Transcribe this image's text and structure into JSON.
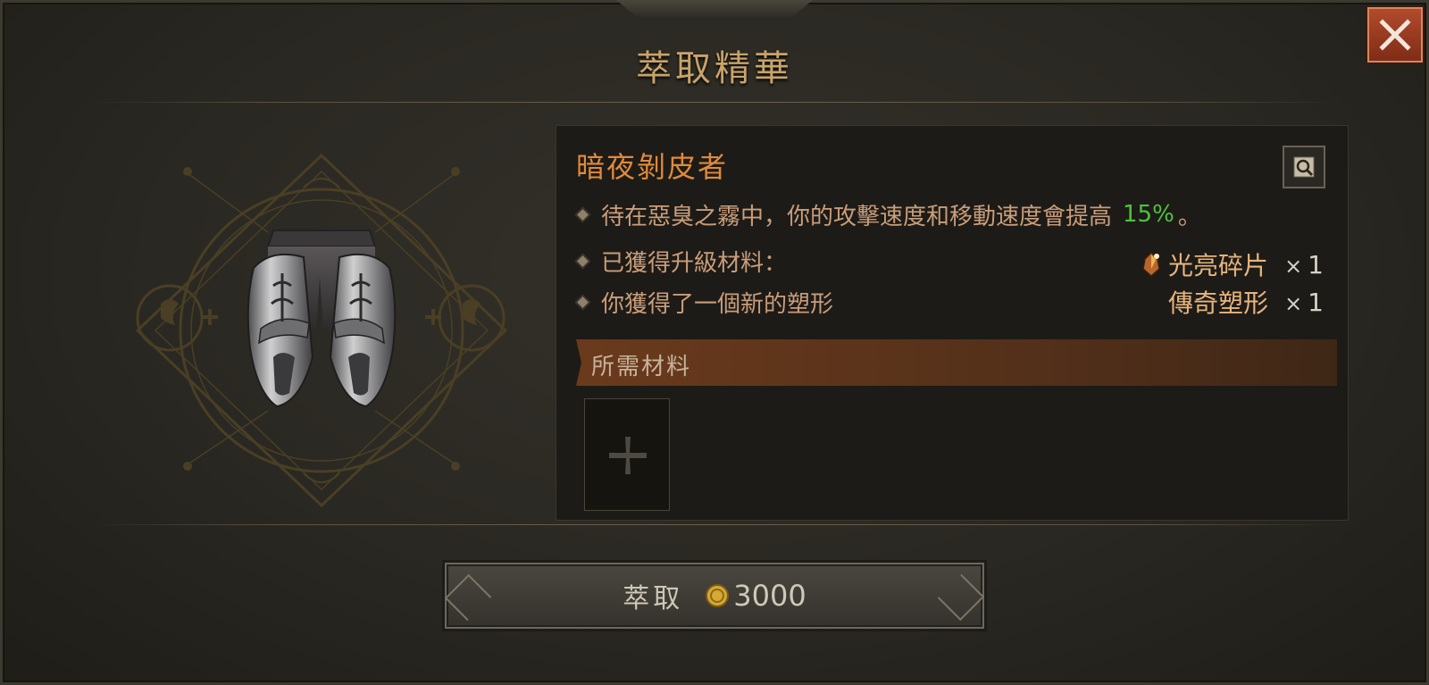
{
  "dialog": {
    "title": "萃取精華",
    "close_icon": "close-icon"
  },
  "item": {
    "name": "暗夜剝皮者",
    "image_icon": "leg-armor-pants-icon",
    "inspect_icon": "magnify-scroll-icon"
  },
  "effects": [
    {
      "text": "待在惡臭之霧中，你的攻擊速度和移動速度會提高",
      "value": "15%",
      "suffix": "。"
    },
    {
      "text": "已獲得升級材料："
    },
    {
      "text": "你獲得了一個新的塑形"
    }
  ],
  "rewards": [
    {
      "name": "光亮碎片",
      "prefix": "×",
      "count": "1",
      "icon": "shard-icon"
    },
    {
      "name": "傳奇塑形",
      "prefix": "×",
      "count": "1"
    }
  ],
  "requirements": {
    "label": "所需材料",
    "slot_icon": "cross-icon"
  },
  "action": {
    "label": "萃取",
    "coin_icon": "gold-coin-icon",
    "cost": "3000"
  },
  "colors": {
    "title": "#c9a36a",
    "item_name": "#e08a3c",
    "effect_text": "#c99d7a",
    "percent": "#4fc23d",
    "reward": "#e7b47c",
    "close_button": "#9a3a20"
  }
}
